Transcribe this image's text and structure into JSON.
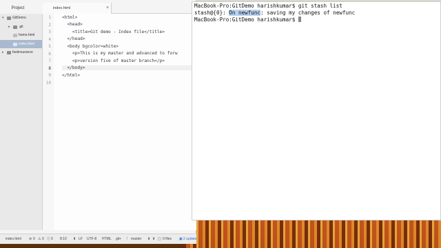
{
  "editor": {
    "tree_tab_label": "Project",
    "tree": [
      {
        "label": "GitDemo",
        "type": "folder",
        "open": true,
        "depth": 0
      },
      {
        "label": ".git",
        "type": "folder",
        "open": false,
        "depth": 1
      },
      {
        "label": "home.html",
        "type": "file",
        "depth": 1
      },
      {
        "label": "index.html",
        "type": "file",
        "depth": 1,
        "selected": true
      },
      {
        "label": "fastinsurance",
        "type": "folder",
        "open": false,
        "depth": 0
      }
    ],
    "active_tab": "index.html",
    "line_numbers": [
      "1",
      "2",
      "3",
      "4",
      "5",
      "6",
      "7",
      "8",
      "9",
      "10"
    ],
    "code_lines": [
      "<html>",
      "  <head>",
      "    <title>Git demo - Index file</title>",
      "  </head>",
      "  <body bgcolor=white>",
      "    <p>This is my master and advanced to forw",
      "    <p>version five of master branch</p>",
      "  </body>",
      "</html>",
      ""
    ],
    "status": {
      "file": "index.html",
      "errors": "0",
      "warnings": "0",
      "info": "0",
      "position": "8:10",
      "line_ending": "LF",
      "encoding": "UTF-8",
      "grammar": "HTML",
      "git_label": "git+",
      "branch": "master",
      "files": "0 files",
      "updates": "2 update"
    }
  },
  "terminal": {
    "line1": "MacBook-Pro:GitDemo harishkumar$ git stash list",
    "line2_prefix": "stash@{0}: ",
    "line2_highlight": "On newfunc",
    "line2_suffix": ": saving my changes of newfunc",
    "line3": "MacBook-Pro:GitDemo harishkumar$ "
  }
}
